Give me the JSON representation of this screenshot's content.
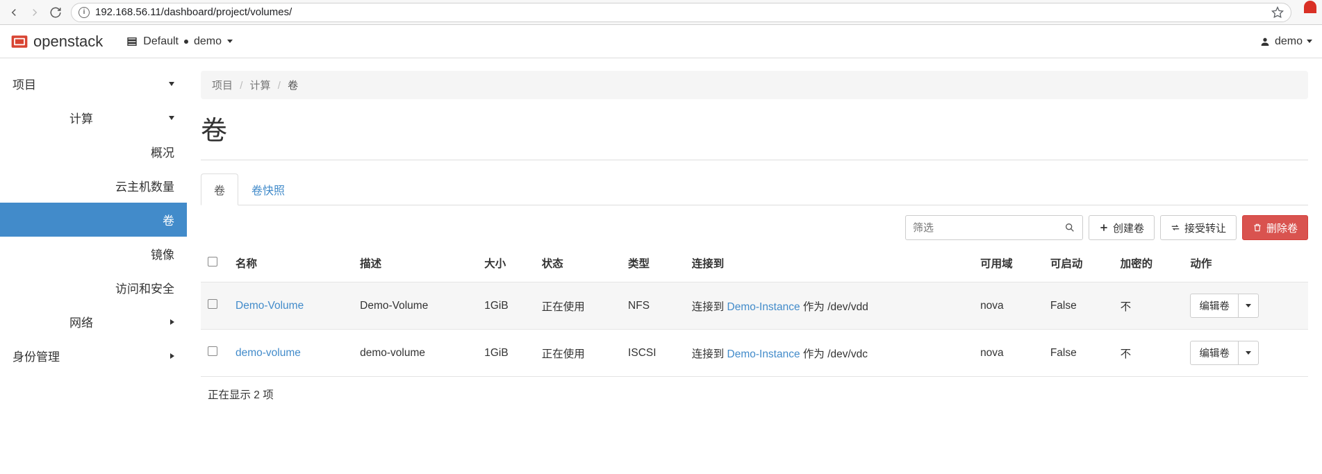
{
  "browser": {
    "url": "192.168.56.11/dashboard/project/volumes/"
  },
  "header": {
    "brand": "openstack",
    "domain_label": "Default",
    "project_label": "demo",
    "user_label": "demo"
  },
  "sidebar": {
    "project": "项目",
    "compute": "计算",
    "leaves": {
      "overview": "概况",
      "instances": "云主机数量",
      "volumes": "卷",
      "images": "镜像",
      "access": "访问和安全"
    },
    "network": "网络",
    "identity": "身份管理"
  },
  "breadcrumb": {
    "a": "项目",
    "b": "计算",
    "c": "卷"
  },
  "page_title": "卷",
  "tabs": {
    "volumes": "卷",
    "snapshots": "卷快照"
  },
  "toolbar": {
    "filter_placeholder": "筛选",
    "create": "创建卷",
    "accept": "接受转让",
    "delete": "删除卷"
  },
  "table": {
    "headers": {
      "name": "名称",
      "desc": "描述",
      "size": "大小",
      "status": "状态",
      "type": "类型",
      "attached": "连接到",
      "zone": "可用域",
      "bootable": "可启动",
      "encrypted": "加密的",
      "actions": "动作"
    },
    "rows": [
      {
        "name": "Demo-Volume",
        "desc": "Demo-Volume",
        "size": "1GiB",
        "status": "正在使用",
        "type": "NFS",
        "attached_prefix": "连接到 ",
        "attached_instance": "Demo-Instance",
        "attached_suffix": " 作为 /dev/vdd",
        "zone": "nova",
        "bootable": "False",
        "encrypted": "不",
        "action": "编辑卷"
      },
      {
        "name": "demo-volume",
        "desc": "demo-volume",
        "size": "1GiB",
        "status": "正在使用",
        "type": "ISCSI",
        "attached_prefix": "连接到 ",
        "attached_instance": "Demo-Instance",
        "attached_suffix": " 作为 /dev/vdc",
        "zone": "nova",
        "bootable": "False",
        "encrypted": "不",
        "action": "编辑卷"
      }
    ],
    "footer": "正在显示 2 项"
  }
}
